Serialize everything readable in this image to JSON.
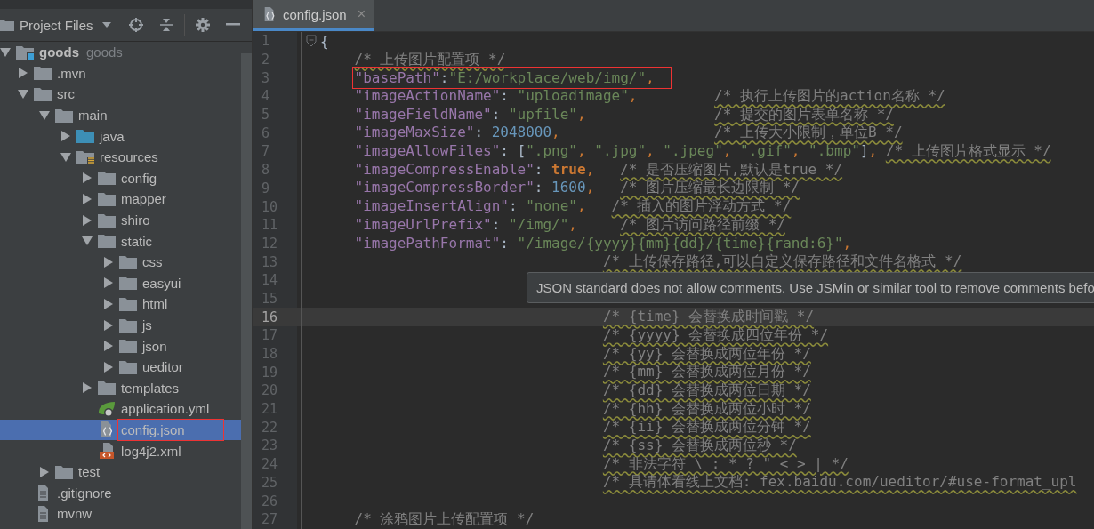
{
  "sidebar": {
    "title": "Project Files"
  },
  "tree": [
    {
      "name": "goods",
      "hint": "goods",
      "kind": "module",
      "expanded": true,
      "children": [
        {
          "name": ".mvn",
          "kind": "folder",
          "expanded": false
        },
        {
          "name": "src",
          "kind": "folder",
          "expanded": true,
          "children": [
            {
              "name": "main",
              "kind": "folder",
              "expanded": true,
              "children": [
                {
                  "name": "java",
                  "kind": "source",
                  "expanded": false
                },
                {
                  "name": "resources",
                  "kind": "resources",
                  "expanded": true,
                  "children": [
                    {
                      "name": "config",
                      "kind": "folder",
                      "expanded": false
                    },
                    {
                      "name": "mapper",
                      "kind": "folder",
                      "expanded": false
                    },
                    {
                      "name": "shiro",
                      "kind": "folder",
                      "expanded": false
                    },
                    {
                      "name": "static",
                      "kind": "folder",
                      "expanded": true,
                      "children": [
                        {
                          "name": "css",
                          "kind": "folder",
                          "expanded": false
                        },
                        {
                          "name": "easyui",
                          "kind": "folder",
                          "expanded": false
                        },
                        {
                          "name": "html",
                          "kind": "folder",
                          "expanded": false
                        },
                        {
                          "name": "js",
                          "kind": "folder",
                          "expanded": false
                        },
                        {
                          "name": "json",
                          "kind": "folder",
                          "expanded": false
                        },
                        {
                          "name": "ueditor",
                          "kind": "folder",
                          "expanded": false
                        }
                      ]
                    },
                    {
                      "name": "templates",
                      "kind": "folder",
                      "expanded": false
                    },
                    {
                      "name": "application.yml",
                      "kind": "yml",
                      "selected": false,
                      "annotated": false
                    },
                    {
                      "name": "config.json",
                      "kind": "json",
                      "selected": true,
                      "annotated": true
                    },
                    {
                      "name": "log4j2.xml",
                      "kind": "xml",
                      "selected": false,
                      "annotated": false
                    }
                  ]
                }
              ]
            },
            {
              "name": "test",
              "kind": "folder",
              "expanded": false
            }
          ]
        },
        {
          "name": ".gitignore",
          "kind": "text",
          "selected": false,
          "annotated": false
        },
        {
          "name": "mvnw",
          "kind": "text",
          "selected": false,
          "annotated": false
        }
      ]
    }
  ],
  "tab": {
    "label": "config.json",
    "close": "×"
  },
  "lines": [
    {
      "number": "1",
      "current": false,
      "code": [
        {
          "kind": "punct",
          "text": "{"
        }
      ]
    },
    {
      "number": "2",
      "current": false,
      "kind": "inner",
      "comment": {
        "text": "/* 上传图片配置项 */",
        "flagged": true,
        "kind": "after"
      }
    },
    {
      "number": "3",
      "current": false,
      "kind": "inner",
      "annotated": true,
      "code": [
        {
          "kind": "key",
          "text": "\"basePath\""
        },
        {
          "kind": "punct",
          "text": ":"
        },
        {
          "kind": "string",
          "text": "\"E:/workplace/web/img/\""
        },
        {
          "kind": "comma",
          "text": ","
        }
      ]
    },
    {
      "number": "4",
      "current": false,
      "kind": "inner",
      "code": [
        {
          "kind": "key",
          "text": "\"imageActionName\""
        },
        {
          "kind": "punct",
          "text": ": "
        },
        {
          "kind": "string",
          "text": "\"uploadimage\""
        },
        {
          "kind": "comma",
          "text": ","
        }
      ],
      "comment": {
        "text": "/* 执行上传图片的action名称 */",
        "flagged": true,
        "kind": "far"
      }
    },
    {
      "number": "5",
      "current": false,
      "kind": "inner",
      "code": [
        {
          "kind": "key",
          "text": "\"imageFieldName\""
        },
        {
          "kind": "punct",
          "text": ": "
        },
        {
          "kind": "string",
          "text": "\"upfile\""
        },
        {
          "kind": "comma",
          "text": ","
        }
      ],
      "comment": {
        "text": "/* 提交的图片表单名称 */",
        "flagged": true,
        "kind": "far"
      }
    },
    {
      "number": "6",
      "current": false,
      "kind": "inner",
      "code": [
        {
          "kind": "key",
          "text": "\"imageMaxSize\""
        },
        {
          "kind": "punct",
          "text": ": "
        },
        {
          "kind": "number",
          "text": "2048000"
        },
        {
          "kind": "comma",
          "text": ","
        }
      ],
      "comment": {
        "text": "/* 上传大小限制，单位B */",
        "flagged": true,
        "kind": "far"
      }
    },
    {
      "number": "7",
      "current": false,
      "kind": "inner",
      "code": [
        {
          "kind": "key",
          "text": "\"imageAllowFiles\""
        },
        {
          "kind": "punct",
          "text": ": ["
        },
        {
          "kind": "string",
          "text": "\".png\""
        },
        {
          "kind": "comma",
          "text": ", "
        },
        {
          "kind": "string",
          "text": "\".jpg\""
        },
        {
          "kind": "comma",
          "text": ", "
        },
        {
          "kind": "string",
          "text": "\".jpeg\""
        },
        {
          "kind": "comma",
          "text": ", "
        },
        {
          "kind": "string",
          "text": "\".gif\""
        },
        {
          "kind": "comma",
          "text": ", "
        },
        {
          "kind": "string",
          "text": "\".bmp\""
        },
        {
          "kind": "punct",
          "text": "]"
        },
        {
          "kind": "comma",
          "text": ","
        }
      ],
      "comment": {
        "text": "/* 上传图片格式显示 */",
        "flagged": true,
        "kind": "after"
      }
    },
    {
      "number": "8",
      "current": false,
      "kind": "inner",
      "code": [
        {
          "kind": "key",
          "text": "\"imageCompressEnable\""
        },
        {
          "kind": "punct",
          "text": ": "
        },
        {
          "kind": "keyword",
          "text": "true"
        },
        {
          "kind": "comma",
          "text": ","
        }
      ],
      "comment": {
        "text": "/* 是否压缩图片,默认是true */",
        "flagged": true,
        "kind": "mid"
      }
    },
    {
      "number": "9",
      "current": false,
      "kind": "inner",
      "code": [
        {
          "kind": "key",
          "text": "\"imageCompressBorder\""
        },
        {
          "kind": "punct",
          "text": ": "
        },
        {
          "kind": "number",
          "text": "1600"
        },
        {
          "kind": "comma",
          "text": ","
        }
      ],
      "comment": {
        "text": "/* 图片压缩最长边限制 */",
        "flagged": true,
        "kind": "mid"
      }
    },
    {
      "number": "10",
      "current": false,
      "kind": "inner",
      "code": [
        {
          "kind": "key",
          "text": "\"imageInsertAlign\""
        },
        {
          "kind": "punct",
          "text": ": "
        },
        {
          "kind": "string",
          "text": "\"none\""
        },
        {
          "kind": "comma",
          "text": ","
        }
      ],
      "comment": {
        "text": "/* 插入的图片浮动方式 */",
        "flagged": true,
        "kind": "mid-left"
      }
    },
    {
      "number": "11",
      "current": false,
      "kind": "inner",
      "code": [
        {
          "kind": "key",
          "text": "\"imageUrlPrefix\""
        },
        {
          "kind": "punct",
          "text": ": "
        },
        {
          "kind": "string",
          "text": "\"/img/\""
        },
        {
          "kind": "comma",
          "text": ","
        }
      ],
      "comment": {
        "text": "/* 图片访问路径前缀 */",
        "flagged": true,
        "kind": "mid"
      }
    },
    {
      "number": "12",
      "current": false,
      "kind": "inner",
      "code": [
        {
          "kind": "key",
          "text": "\"imagePathFormat\""
        },
        {
          "kind": "punct",
          "text": ": "
        },
        {
          "kind": "string",
          "text": "\"/image/{yyyy}{mm}{dd}/{time}{rand:6}\""
        },
        {
          "kind": "comma",
          "text": ","
        }
      ]
    },
    {
      "number": "13",
      "current": false,
      "comment": {
        "text": "/* 上传保存路径,可以自定义保存路径和文件名格式 */",
        "flagged": true,
        "kind": "block"
      }
    },
    {
      "number": "14",
      "current": false
    },
    {
      "number": "15",
      "current": false
    },
    {
      "number": "16",
      "current": true,
      "comment": {
        "text": "/* {time} 会替换成时间戳 */",
        "flagged": true,
        "kind": "block"
      }
    },
    {
      "number": "17",
      "current": false,
      "comment": {
        "text": "/* {yyyy} 会替换成四位年份 */",
        "flagged": true,
        "kind": "block"
      }
    },
    {
      "number": "18",
      "current": false,
      "comment": {
        "text": "/* {yy} 会替换成两位年份 */",
        "flagged": true,
        "kind": "block"
      }
    },
    {
      "number": "19",
      "current": false,
      "comment": {
        "text": "/* {mm} 会替换成两位月份 */",
        "flagged": true,
        "kind": "block"
      }
    },
    {
      "number": "20",
      "current": false,
      "comment": {
        "text": "/* {dd} 会替换成两位日期 */",
        "flagged": true,
        "kind": "block"
      }
    },
    {
      "number": "21",
      "current": false,
      "comment": {
        "text": "/* {hh} 会替换成两位小时 */",
        "flagged": true,
        "kind": "block"
      }
    },
    {
      "number": "22",
      "current": false,
      "comment": {
        "text": "/* {ii} 会替换成两位分钟 */",
        "flagged": true,
        "kind": "block"
      }
    },
    {
      "number": "23",
      "current": false,
      "comment": {
        "text": "/* {ss} 会替换成两位秒 */",
        "flagged": true,
        "kind": "block"
      }
    },
    {
      "number": "24",
      "current": false,
      "comment": {
        "text": "/* 非法字符 \\ : * ? \" < > | */",
        "flagged": true,
        "kind": "block"
      }
    },
    {
      "number": "25",
      "current": false,
      "comment": {
        "text": "/* 具请体看线上文档: fex.baidu.com/ueditor/#use-format_upl",
        "flagged": true,
        "kind": "block"
      }
    },
    {
      "number": "26",
      "current": false
    },
    {
      "number": "27",
      "current": false,
      "kind": "inner",
      "comment": {
        "text": "/* 涂鸦图片上传配置项 */",
        "flagged": false,
        "kind": "after"
      }
    }
  ],
  "tooltip": {
    "text": "JSON standard does not allow comments. Use JSMin or similar tool to remove comments befo"
  }
}
